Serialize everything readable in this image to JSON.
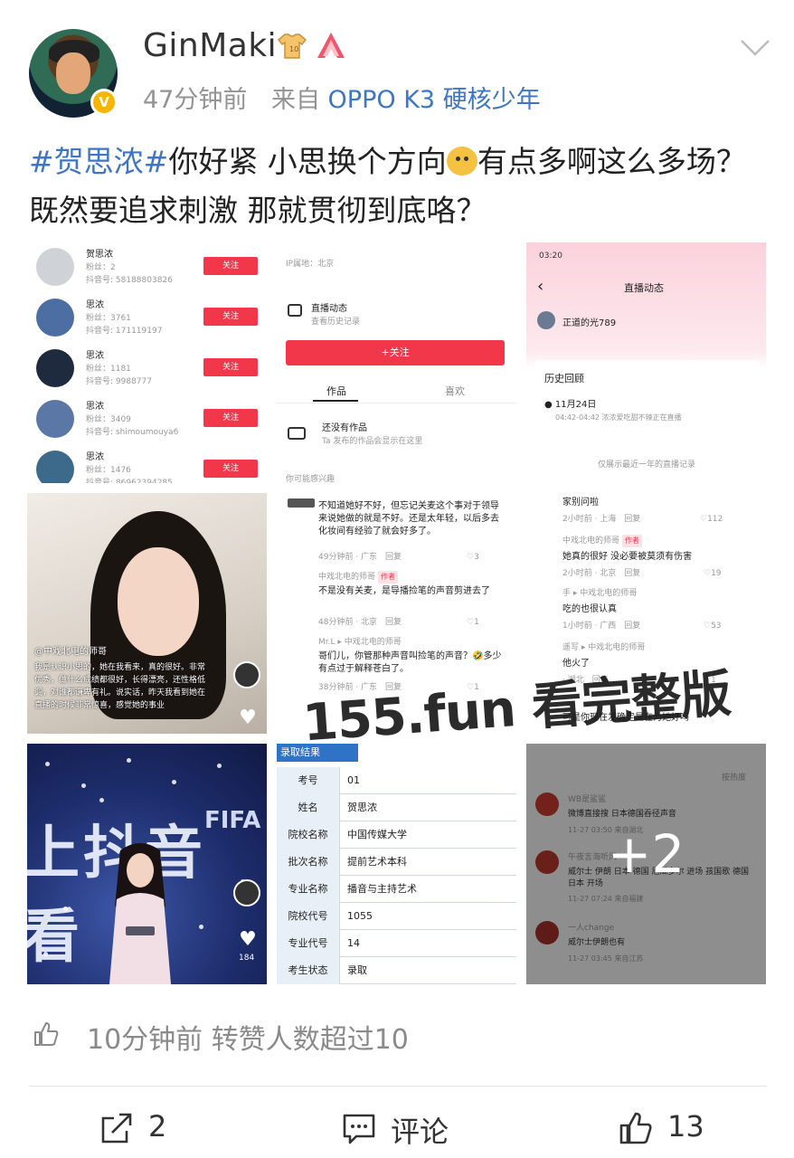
{
  "header": {
    "username": "GinMaki",
    "time": "47分钟前",
    "from_label": "来自",
    "device": "OPPO K3 硬核少年",
    "verified_badge": "V"
  },
  "post": {
    "topic": "#贺思浓#",
    "text_a": "你好紧 小思换个方向",
    "text_b": "有点多啊这么多场？既然要追求刺激 那就贯彻到底咯？"
  },
  "tiles": {
    "users": [
      {
        "name": "贺思浓",
        "fans": "粉丝：2",
        "id": "抖音号: 58188803826",
        "button": "关注"
      },
      {
        "name": "思浓",
        "fans": "粉丝：3761",
        "id": "抖音号: 171119197",
        "button": "关注"
      },
      {
        "name": "思浓",
        "fans": "粉丝：1181",
        "id": "抖音号: 9988777",
        "button": "关注"
      },
      {
        "name": "思浓",
        "fans": "粉丝：3409",
        "id": "抖音号: shimoumouya6",
        "button": "关注"
      },
      {
        "name": "思浓",
        "fans": "粉丝：1476",
        "id": "抖音号: 86962394285",
        "button": "关注"
      }
    ],
    "profile": {
      "ip": "IP属地：北京",
      "live_title": "直播动态",
      "live_sub": "查看历史记录",
      "follow": "+关注",
      "tab_works": "作品",
      "tab_likes": "喜欢",
      "empty_title": "还没有作品",
      "empty_sub": "Ta 发布的作品会显示在这里",
      "maybe": "你可能感兴趣"
    },
    "live": {
      "time": "03:20",
      "title": "直播动态",
      "user": "正道的光789",
      "history": "历史回顾",
      "date": "11月24日",
      "entry": "04:42-04:42 浓浓爱吃甜不辣正在直播",
      "footer": "仅展示最近一年的直播记录"
    },
    "video1": {
      "author": "@中戏北电的师哥",
      "caption": "我是认识小思的，她在我看来，真的很好。非常优秀，做什么成绩都很好，长得漂亮，还性格低调，对谁都谦卑有礼。说实话，昨天我看到她在直播的时候非常惊喜，感觉她的事业"
    },
    "comments1": [
      {
        "text": "不知道她好不好，但忘记关麦这个事对于领导来说她做的就是不好。还是太年轻，以后多去化妆间有经验了就会好多了。",
        "meta": "49分钟前 · 广东　回复",
        "likes": "3"
      },
      {
        "user": "中戏北电的师哥",
        "tag": "作者",
        "text": "不是没有关麦，是导播捡笔的声音剪进去了",
        "meta": "48分钟前 · 北京　回复",
        "likes": "1"
      },
      {
        "user": "Mr.L ▸ 中戏北电的师哥",
        "text": "哥们儿，你管那种声音叫捡笔的声音？🤣多少有点过于解释苍白了。",
        "meta": "38分钟前 · 广东　回复",
        "likes": "1"
      }
    ],
    "comments2": [
      {
        "text": "家别问啦",
        "meta": "2小时前 · 上海　回复",
        "likes": "112"
      },
      {
        "user": "中戏北电的师哥",
        "tag": "作者",
        "text": "她真的很好 没必要被莫须有伤害",
        "meta": "2小时前 · 北京　回复",
        "likes": "19"
      },
      {
        "user": "手 ▸ 中戏北电的师哥",
        "text": "吃的也很认真",
        "meta": "1小时前 · 广西　回复",
        "likes": "53"
      },
      {
        "user": "遥写 ▸ 中戏北电的师哥",
        "text": "他火了",
        "meta": "· 湖北　回复",
        "likes": "1"
      },
      {
        "text": "可是你现在发确定是在为她好吗",
        "meta": "",
        "likes": ""
      }
    ],
    "video2": {
      "likes": "184",
      "fifa": "FIFA",
      "bg_text": "上抖音看"
    },
    "table": {
      "header": "录取结果",
      "rows": [
        {
          "k": "考号",
          "v": "01"
        },
        {
          "k": "姓名",
          "v": "贺思浓"
        },
        {
          "k": "院校名称",
          "v": "中国传媒大学"
        },
        {
          "k": "批次名称",
          "v": "提前艺术本科"
        },
        {
          "k": "专业名称",
          "v": "播音与主持艺术"
        },
        {
          "k": "院校代号",
          "v": "1055"
        },
        {
          "k": "专业代号",
          "v": "14"
        },
        {
          "k": "考生状态",
          "v": "录取"
        }
      ]
    },
    "more": {
      "count": "+2",
      "sort": "按热度",
      "comments": [
        {
          "user": "WB是鲨鲨",
          "text": "微博直接搜 日本德国吞径声音",
          "meta": "11-27 03:50 来自湖北"
        },
        {
          "user": "午夜言海听风",
          "text": "威尔士 伊朗 日本 德国 厄瓜多尔 进场 孩国歌 德国 日本 开场",
          "meta": "11-27 07:24 来自福建"
        },
        {
          "user": "一人change",
          "text": "威尔士伊朗也有",
          "meta": "11-27 03:45 来自江苏"
        }
      ]
    }
  },
  "watermark": "155.fun 看完整版",
  "footer": {
    "likes_note": "10分钟前 转赞人数超过10",
    "share_count": "2",
    "comment_label": "评论",
    "like_count": "13"
  },
  "icons": {
    "header": [
      "shirt-badge-icon",
      "rocket-badge-icon",
      "chevron-down-icon"
    ],
    "actions": [
      "share-icon",
      "comment-icon",
      "thumbs-up-icon"
    ]
  },
  "colors": {
    "link": "#3f76c4",
    "accent_red": "#f2374a",
    "meta_gray": "#939393"
  }
}
